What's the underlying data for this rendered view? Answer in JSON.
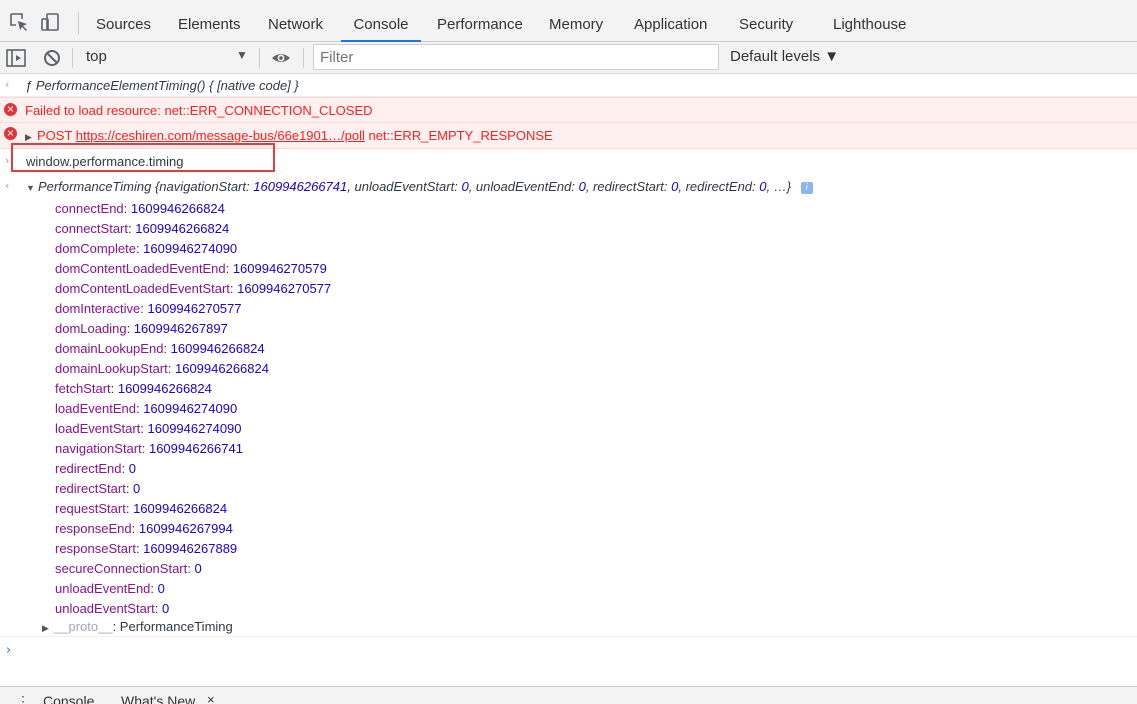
{
  "tabs": [
    "Sources",
    "Elements",
    "Network",
    "Console",
    "Performance",
    "Memory",
    "Application",
    "Security",
    "Lighthouse"
  ],
  "active_tab": "Console",
  "toolbar": {
    "context": "top",
    "filter_placeholder": "Filter",
    "levels": "Default levels ▼"
  },
  "console": {
    "line1": {
      "text": "ƒ PerformanceElementTiming() { [native code] }"
    },
    "error1": {
      "text": "Failed to load resource: net::ERR_CONNECTION_CLOSED"
    },
    "error2": {
      "method": "POST",
      "url": "https://ceshiren.com/message-bus/66e1901…/poll",
      "status": "net::ERR_EMPTY_RESPONSE"
    },
    "command": "window.performance.timing",
    "summary": {
      "name": "PerformanceTiming",
      "preview_start": "{",
      "p1k": "navigationStart",
      "p1v": "1609946266741",
      "p2k": "unloadEventStart",
      "p2v": "0",
      "p3k": "unloadEventEnd",
      "p3v": "0",
      "p4k": "redirectStart",
      "p4v": "0",
      "p5k": "redirectEnd",
      "p5v": "0",
      "preview_end": "…}"
    },
    "props": [
      {
        "k": "connectEnd",
        "v": "1609946266824"
      },
      {
        "k": "connectStart",
        "v": "1609946266824"
      },
      {
        "k": "domComplete",
        "v": "1609946274090"
      },
      {
        "k": "domContentLoadedEventEnd",
        "v": "1609946270579"
      },
      {
        "k": "domContentLoadedEventStart",
        "v": "1609946270577"
      },
      {
        "k": "domInteractive",
        "v": "1609946270577"
      },
      {
        "k": "domLoading",
        "v": "1609946267897"
      },
      {
        "k": "domainLookupEnd",
        "v": "1609946266824"
      },
      {
        "k": "domainLookupStart",
        "v": "1609946266824"
      },
      {
        "k": "fetchStart",
        "v": "1609946266824"
      },
      {
        "k": "loadEventEnd",
        "v": "1609946274090"
      },
      {
        "k": "loadEventStart",
        "v": "1609946274090"
      },
      {
        "k": "navigationStart",
        "v": "1609946266741"
      },
      {
        "k": "redirectEnd",
        "v": "0"
      },
      {
        "k": "redirectStart",
        "v": "0"
      },
      {
        "k": "requestStart",
        "v": "1609946266824"
      },
      {
        "k": "responseEnd",
        "v": "1609946267994"
      },
      {
        "k": "responseStart",
        "v": "1609946267889"
      },
      {
        "k": "secureConnectionStart",
        "v": "0"
      },
      {
        "k": "unloadEventEnd",
        "v": "0"
      },
      {
        "k": "unloadEventStart",
        "v": "0"
      }
    ],
    "proto_key": "__proto__",
    "proto_value": "PerformanceTiming"
  },
  "drawer": {
    "tab1": "Console",
    "tab2": "What's New",
    "close": "×"
  }
}
